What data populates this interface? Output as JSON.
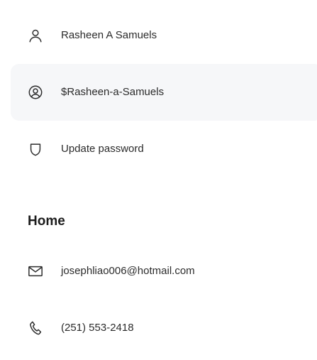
{
  "profile": {
    "items": [
      {
        "icon": "person-icon",
        "label": "Rasheen A Samuels"
      },
      {
        "icon": "user-circle-icon",
        "label": "$Rasheen-a-Samuels"
      },
      {
        "icon": "shield-icon",
        "label": "Update password"
      }
    ]
  },
  "home": {
    "heading": "Home",
    "items": [
      {
        "icon": "mail-icon",
        "label": "josephliao006@hotmail.com"
      },
      {
        "icon": "phone-icon",
        "label": "(251) 553-2418"
      }
    ]
  },
  "colors": {
    "highlight_background": "#f6f7f9",
    "text": "#2b2b2b",
    "icon_stroke": "#2b2b2b"
  }
}
